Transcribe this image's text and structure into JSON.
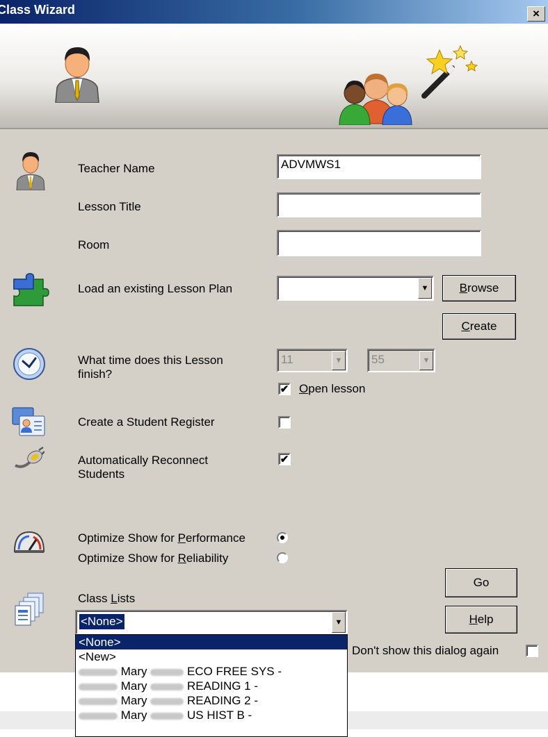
{
  "window": {
    "title": "Class Wizard",
    "close_glyph": "×"
  },
  "icons": {
    "header_person": "teacher-icon",
    "header_group": "students-group-icon",
    "header_wand": "magic-wand-icon",
    "teacher": "teacher-icon",
    "lesson_plan": "puzzle-icon",
    "time": "clock-icon",
    "register": "register-card-icon",
    "reconnect": "plug-icon",
    "optimize": "gauge-icon",
    "class_lists": "documents-icon"
  },
  "form": {
    "teacher_name": {
      "label": "Teacher Name",
      "value": "ADVMWS1"
    },
    "lesson_title": {
      "label": "Lesson Title",
      "value": ""
    },
    "room": {
      "label": "Room",
      "value": ""
    },
    "lesson_plan": {
      "label": "Load an existing Lesson Plan",
      "value": ""
    },
    "browse_prefix": "B",
    "browse_rest": "rowse",
    "create_prefix": "C",
    "create_rest": "reate",
    "finish_time": {
      "label_line1": "What time does this Lesson",
      "label_line2": "finish?",
      "hour": "11",
      "minute": "55"
    },
    "open_lesson": {
      "prefix": "O",
      "rest": "pen lesson",
      "checked": true,
      "mark": "✔"
    },
    "student_register": {
      "label": "Create a Student Register",
      "checked": false,
      "mark": ""
    },
    "auto_reconnect": {
      "label_line1": "Automatically Reconnect",
      "label_line2": "Students",
      "checked": true,
      "mark": "✔"
    },
    "optimize_perf": {
      "pre": "Optimize Show for ",
      "key": "P",
      "post": "erformance",
      "selected": true
    },
    "optimize_rel": {
      "pre": "Optimize Show for ",
      "key": "R",
      "post": "eliability",
      "selected": false
    },
    "class_lists": {
      "label_pre": "Class ",
      "label_key": "L",
      "label_post": "ists",
      "value": "<None>"
    },
    "go_label": "Go",
    "help_prefix": "H",
    "help_rest": "elp",
    "dont_show": {
      "label": "Don't show this dialog again",
      "checked": false
    }
  },
  "class_list_dropdown": [
    {
      "text": "<None>",
      "selected": true
    },
    {
      "text": "<New>",
      "selected": false
    },
    {
      "first": "Mary",
      "name": "ECO FREE SYS -"
    },
    {
      "first": "Mary",
      "name": "READING 1  -"
    },
    {
      "first": "Mary",
      "name": "READING 2 -"
    },
    {
      "first": "Mary",
      "name": "US HIST B -"
    }
  ],
  "colors": {
    "accent": "#0a246a",
    "face": "#d4d0c8"
  }
}
